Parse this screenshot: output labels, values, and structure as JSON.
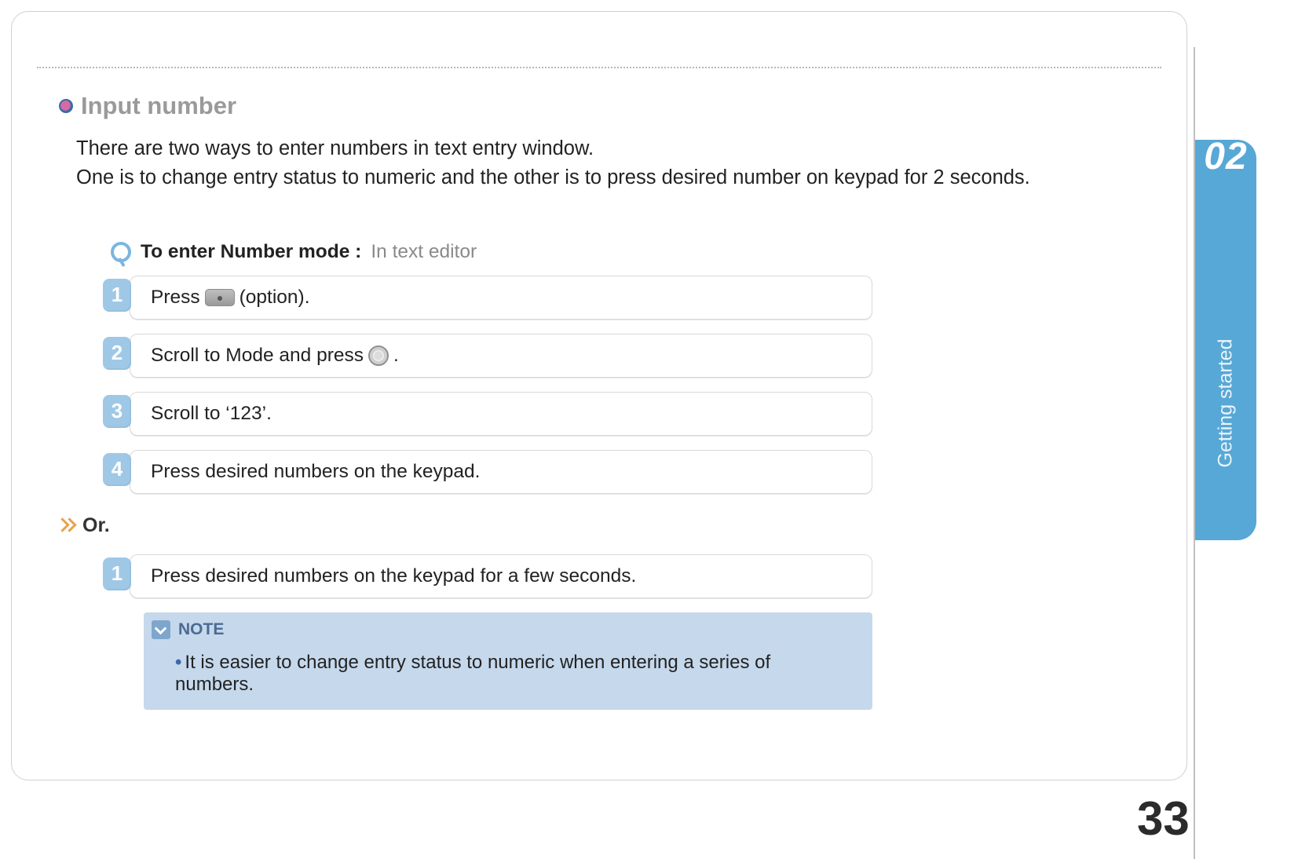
{
  "header": {
    "title": "Input number"
  },
  "intro": {
    "line1": "There are two ways to enter numbers in text entry window.",
    "line2": "One is to change entry status to numeric and the other is to press desired number on keypad for 2 seconds."
  },
  "mode": {
    "label": "To enter Number mode :",
    "context": "In text editor"
  },
  "steps_a": [
    {
      "num": "1",
      "pre": "Press ",
      "icon": "softkey",
      "post": " (option)."
    },
    {
      "num": "2",
      "pre": "Scroll to Mode and press ",
      "icon": "nav",
      "post": "."
    },
    {
      "num": "3",
      "pre": "Scroll to ‘123’.",
      "icon": null,
      "post": ""
    },
    {
      "num": "4",
      "pre": "Press desired numbers on the keypad.",
      "icon": null,
      "post": ""
    }
  ],
  "or_label": "Or.",
  "steps_b": [
    {
      "num": "1",
      "pre": "Press desired numbers on the keypad for a few seconds.",
      "icon": null,
      "post": ""
    }
  ],
  "note": {
    "title": "NOTE",
    "body": "It is easier to change entry status to numeric when entering a series of numbers."
  },
  "tab": {
    "chapter_num": "02",
    "chapter_label": "Getting started"
  },
  "page_number": "33"
}
